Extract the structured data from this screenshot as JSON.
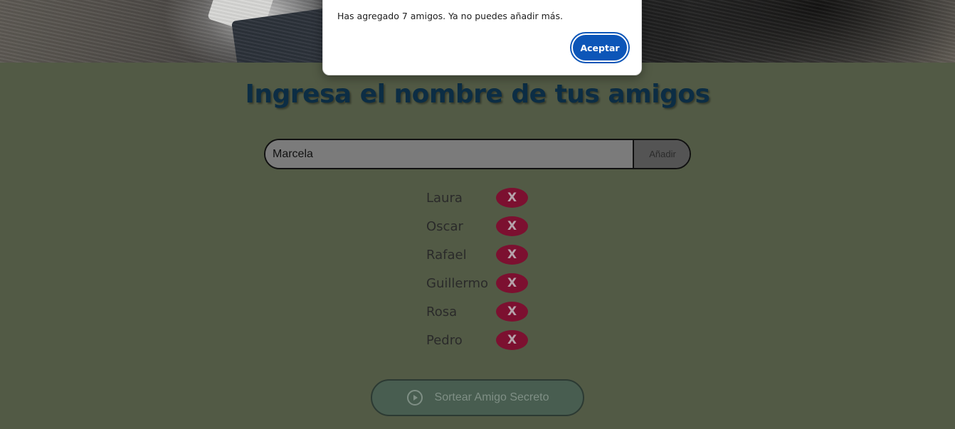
{
  "page": {
    "title": "Ingresa el nombre de tus amigos"
  },
  "input": {
    "value": "Marcela",
    "add_label": "Añadir"
  },
  "friends": [
    {
      "name": "Laura",
      "remove_label": "X"
    },
    {
      "name": "Oscar",
      "remove_label": "X"
    },
    {
      "name": "Rafael",
      "remove_label": "X"
    },
    {
      "name": "Guillermo",
      "remove_label": "X"
    },
    {
      "name": "Rosa",
      "remove_label": "X"
    },
    {
      "name": "Pedro",
      "remove_label": "X"
    }
  ],
  "draw_button": {
    "label": "Sortear Amigo Secreto",
    "icon": "play-circle-icon"
  },
  "dialog": {
    "message": "Has agregado 7 amigos. Ya no puedes añadir más.",
    "ok_label": "Aceptar"
  },
  "colors": {
    "background": "#525a45",
    "title": "#0c2d44",
    "remove_button": "#7c1030",
    "draw_button": "#485d50",
    "ok_button": "#0d56b8"
  }
}
